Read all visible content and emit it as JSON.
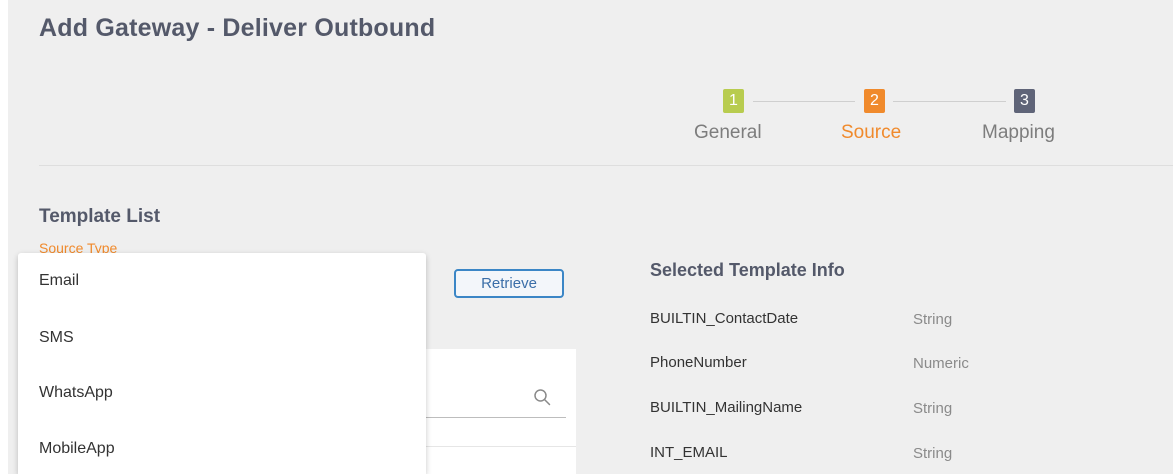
{
  "header": {
    "title": "Add Gateway - Deliver Outbound"
  },
  "stepper": {
    "steps": [
      {
        "number": "1",
        "label": "General",
        "color": "#b8cc4f",
        "label_color": "#7d7d7d",
        "state": "completed"
      },
      {
        "number": "2",
        "label": "Source",
        "color": "#f08a2c",
        "label_color": "#f08a2c",
        "state": "active"
      },
      {
        "number": "3",
        "label": "Mapping",
        "color": "#5f6478",
        "label_color": "#7d7d7d",
        "state": "upcoming"
      }
    ]
  },
  "template_list": {
    "title": "Template List",
    "source_type_label": "Source Type",
    "source_type_options": [
      "Email",
      "SMS",
      "WhatsApp",
      "MobileApp"
    ],
    "retrieve_label": "Retrieve"
  },
  "selected_template_info": {
    "title": "Selected Template Info",
    "fields": [
      {
        "name": "BUILTIN_ContactDate",
        "type": "String"
      },
      {
        "name": "PhoneNumber",
        "type": "Numeric"
      },
      {
        "name": "BUILTIN_MailingName",
        "type": "String"
      },
      {
        "name": "INT_EMAIL",
        "type": "String"
      }
    ]
  },
  "icons": {
    "search": "search-icon"
  },
  "colors": {
    "accent_orange": "#f08a2c",
    "button_blue": "#3b86c6",
    "heading_gray": "#54596a"
  }
}
